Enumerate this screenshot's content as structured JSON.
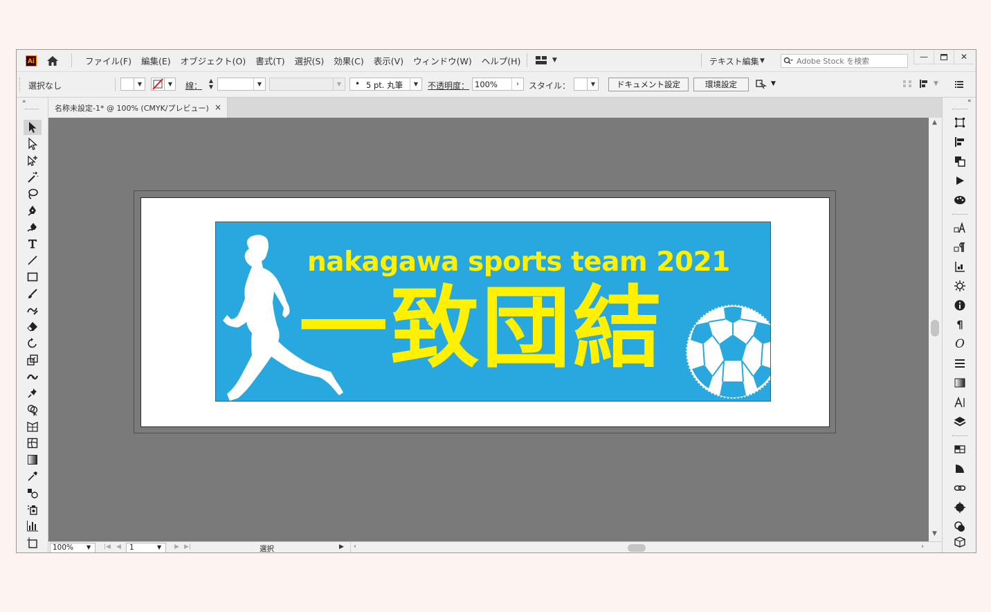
{
  "menubar": {
    "app_icon": "Ai",
    "items": [
      "ファイル(F)",
      "編集(E)",
      "オブジェクト(O)",
      "書式(T)",
      "選択(S)",
      "効果(C)",
      "表示(V)",
      "ウィンドウ(W)",
      "ヘルプ(H)"
    ],
    "text_edit": "テキスト編集",
    "search_placeholder": "Adobe Stock を検索"
  },
  "controlbar": {
    "selection": "選択なし",
    "stroke_label": "線：",
    "brush": "5 pt. 丸筆",
    "opacity_label": "不透明度：",
    "opacity_value": "100%",
    "style_label": "スタイル：",
    "doc_settings": "ドキュメント設定",
    "preferences": "環境設定"
  },
  "tab": {
    "title": "名称未設定-1* @ 100% (CMYK/プレビュー)",
    "close": "×"
  },
  "artwork": {
    "subtitle": "nakagawa sports team 2021",
    "headline": "一致団結",
    "banner_color": "#29a8df",
    "text_color": "#fff100"
  },
  "statusbar": {
    "zoom": "100%",
    "page": "1",
    "mode": "選択"
  },
  "colors": {
    "canvas": "#7a7a7a",
    "bleed": "#d0171e",
    "chrome": "#f0f0f0"
  }
}
